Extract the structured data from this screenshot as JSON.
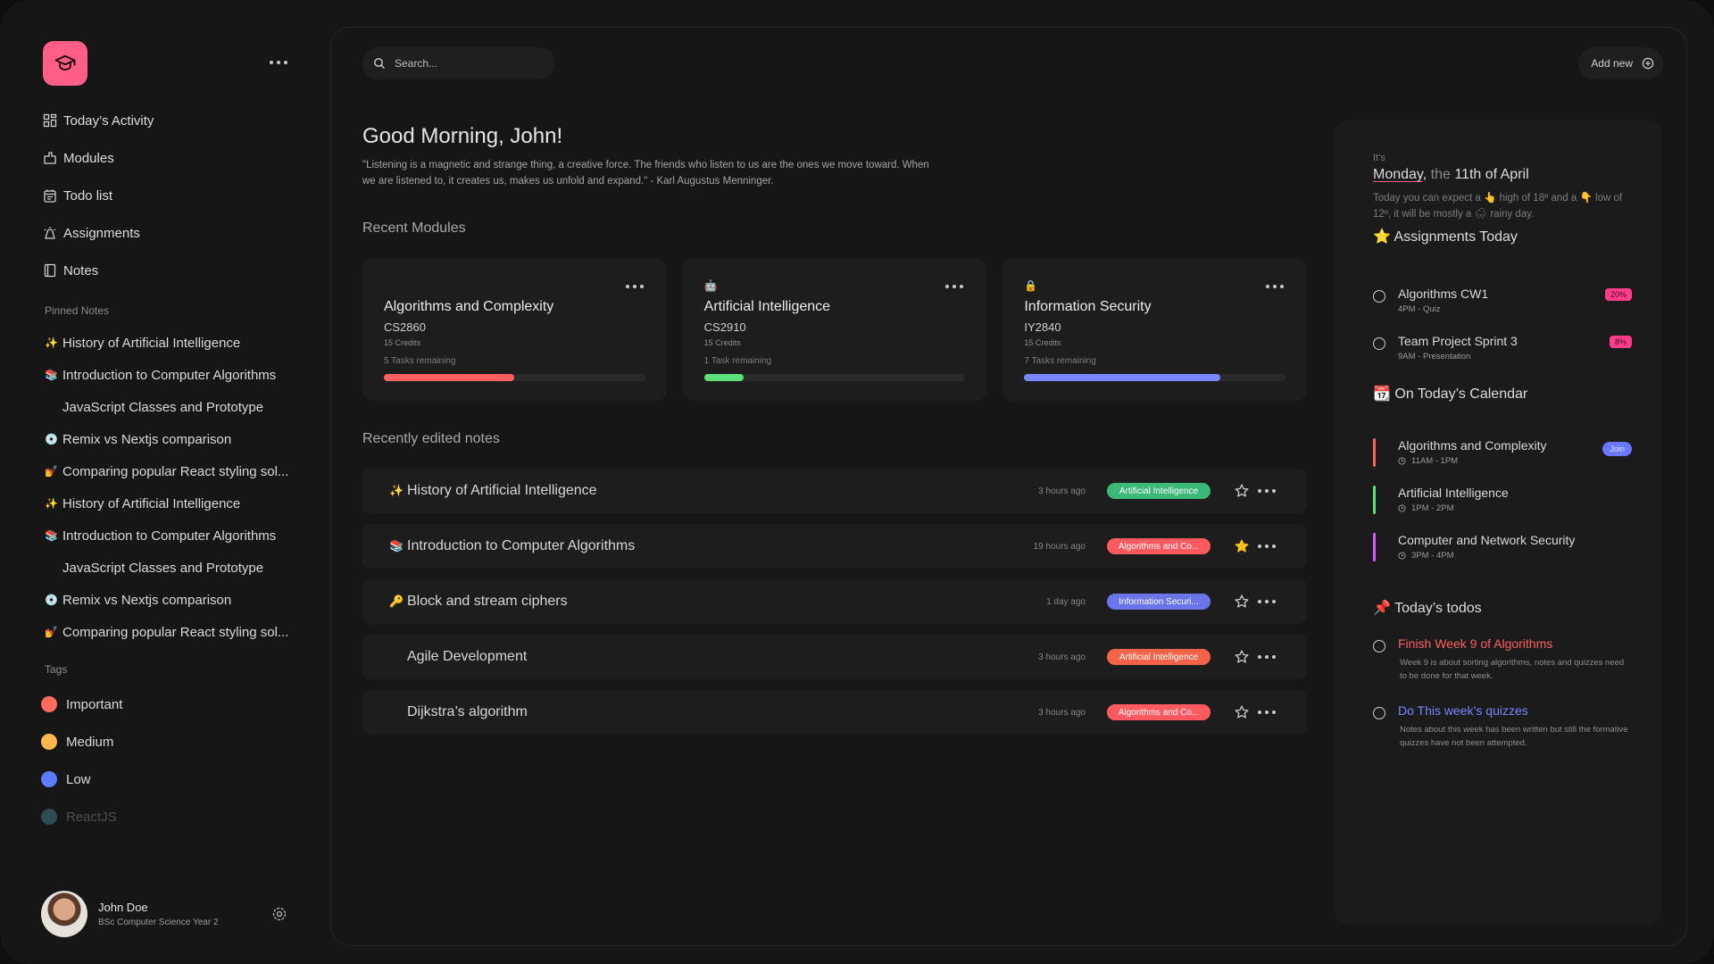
{
  "sidebar": {
    "nav": [
      {
        "label": "Today’s Activity",
        "icon": "grid-icon"
      },
      {
        "label": "Modules",
        "icon": "module-icon"
      },
      {
        "label": "Todo list",
        "icon": "calendar-icon"
      },
      {
        "label": "Assignments",
        "icon": "alarm-icon"
      },
      {
        "label": "Notes",
        "icon": "notebook-icon"
      }
    ],
    "pinned_label": "Pinned Notes",
    "pinned": [
      {
        "emoji": "✨",
        "label": "History of Artificial Intelligence"
      },
      {
        "emoji": "📚",
        "label": "Introduction to Computer Algorithms"
      },
      {
        "emoji": "",
        "label": "JavaScript Classes and Prototype"
      },
      {
        "emoji": "💿",
        "label": "Remix vs Nextjs comparison"
      },
      {
        "emoji": "💅",
        "label": "Comparing popular React styling sol..."
      },
      {
        "emoji": "✨",
        "label": "History of Artificial Intelligence"
      },
      {
        "emoji": "📚",
        "label": "Introduction to Computer Algorithms"
      },
      {
        "emoji": "",
        "label": "JavaScript Classes and Prototype"
      },
      {
        "emoji": "💿",
        "label": "Remix vs Nextjs comparison"
      },
      {
        "emoji": "💅",
        "label": "Comparing popular React styling sol..."
      }
    ],
    "tags_label": "Tags",
    "tags": [
      {
        "label": "Important",
        "color": "#ff6b5e"
      },
      {
        "label": "Medium",
        "color": "#ffb84d"
      },
      {
        "label": "Low",
        "color": "#5b7cff"
      },
      {
        "label": "ReactJS",
        "color": "#2e4a52"
      }
    ],
    "user": {
      "name": "John Doe",
      "subtitle": "BSc Computer Science Year 2"
    }
  },
  "header": {
    "search_placeholder": "Search...",
    "add_new_label": "Add new"
  },
  "main": {
    "greeting": "Good Morning, John!",
    "quote": "\"Listening is a magnetic and strange thing, a creative force. The friends who listen to us are the ones we move toward. When we are listened to, it creates us, makes us unfold and expand.\" - Karl Augustus Menninger.",
    "recent_modules_label": "Recent Modules",
    "modules": [
      {
        "emoji": "",
        "title": "Algorithms and Complexity",
        "code": "CS2860",
        "credits": "15 Credits",
        "tasks": "5 Tasks remaining",
        "progress": 0.5,
        "color": "#ff5f5f"
      },
      {
        "emoji": "🤖",
        "title": "Artificial Intelligence",
        "code": "CS2910",
        "credits": "15 Credits",
        "tasks": "1 Task remaining",
        "progress": 0.15,
        "color": "#5be07a"
      },
      {
        "emoji": "🔒",
        "title": "Information Security",
        "code": "IY2840",
        "credits": "15 Credits",
        "tasks": "7 Tasks remaining",
        "progress": 0.75,
        "color": "#7a86ff"
      }
    ],
    "recent_notes_label": "Recently edited notes",
    "notes": [
      {
        "emoji": "✨",
        "title": "History of Artificial Intelligence",
        "time": "3 hours ago",
        "tag": "Artificial Intelligence",
        "tag_color": "#3cb878",
        "starred": false
      },
      {
        "emoji": "📚",
        "title": "Introduction to Computer Algorithms",
        "time": "19 hours ago",
        "tag": "Algorithms and Co...",
        "tag_color": "#ff5a5f",
        "starred": true
      },
      {
        "emoji": "🔑",
        "title": "Block and stream ciphers",
        "time": "1 day ago",
        "tag": "Information Securi...",
        "tag_color": "#6b74e8",
        "starred": false
      },
      {
        "emoji": "",
        "title": "Agile Development",
        "time": "3 hours ago",
        "tag": "Artificial Intelligence",
        "tag_color": "#f2634a",
        "starred": false
      },
      {
        "emoji": "",
        "title": "Dijkstra’s algorithm",
        "time": "3 hours ago",
        "tag": "Algorithms and Co...",
        "tag_color": "#ff5a5f",
        "starred": false
      }
    ]
  },
  "right": {
    "its": "It’s",
    "day": "Monday",
    "the": "the",
    "date": "11th of April",
    "weather_parts": [
      "Today you can expect a",
      "👆",
      "high of 18º and a",
      "👇",
      "low of 12º, it will be mostly a",
      "🌧",
      "rainy day."
    ],
    "assignments_heading": "Assignments Today",
    "assignments_emoji": "⭐",
    "assignments": [
      {
        "title": "Algorithms CW1",
        "sub": "4PM - Quiz",
        "pct": "20%"
      },
      {
        "title": "Team Project Sprint 3",
        "sub": "9AM - Presentation",
        "pct": "8%"
      }
    ],
    "calendar_heading": "On Today’s Calendar",
    "calendar_emoji": "📆",
    "calendar": [
      {
        "title": "Algorithms and Complexity",
        "time": "11AM - 1PM",
        "color": "#ff5f5f",
        "join": "Join"
      },
      {
        "title": "Artificial Intelligence",
        "time": "1PM - 2PM",
        "color": "#5be07a",
        "join": ""
      },
      {
        "title": "Computer and Network Security",
        "time": "3PM - 4PM",
        "color": "#d65bff",
        "join": ""
      }
    ],
    "todos_heading": "Today’s todos",
    "todos_emoji": "📌",
    "todos": [
      {
        "title": "Finish Week 9 of Algorithms",
        "desc": "Week 9 is about sorting algorithms, notes and quizzes need to be done for that week.",
        "color": "#ff5f5f"
      },
      {
        "title": "Do This week’s quizzes",
        "desc": "Notes about this week has been written but still the formative quizzes have not been attempted.",
        "color": "#7a86ff"
      }
    ]
  }
}
